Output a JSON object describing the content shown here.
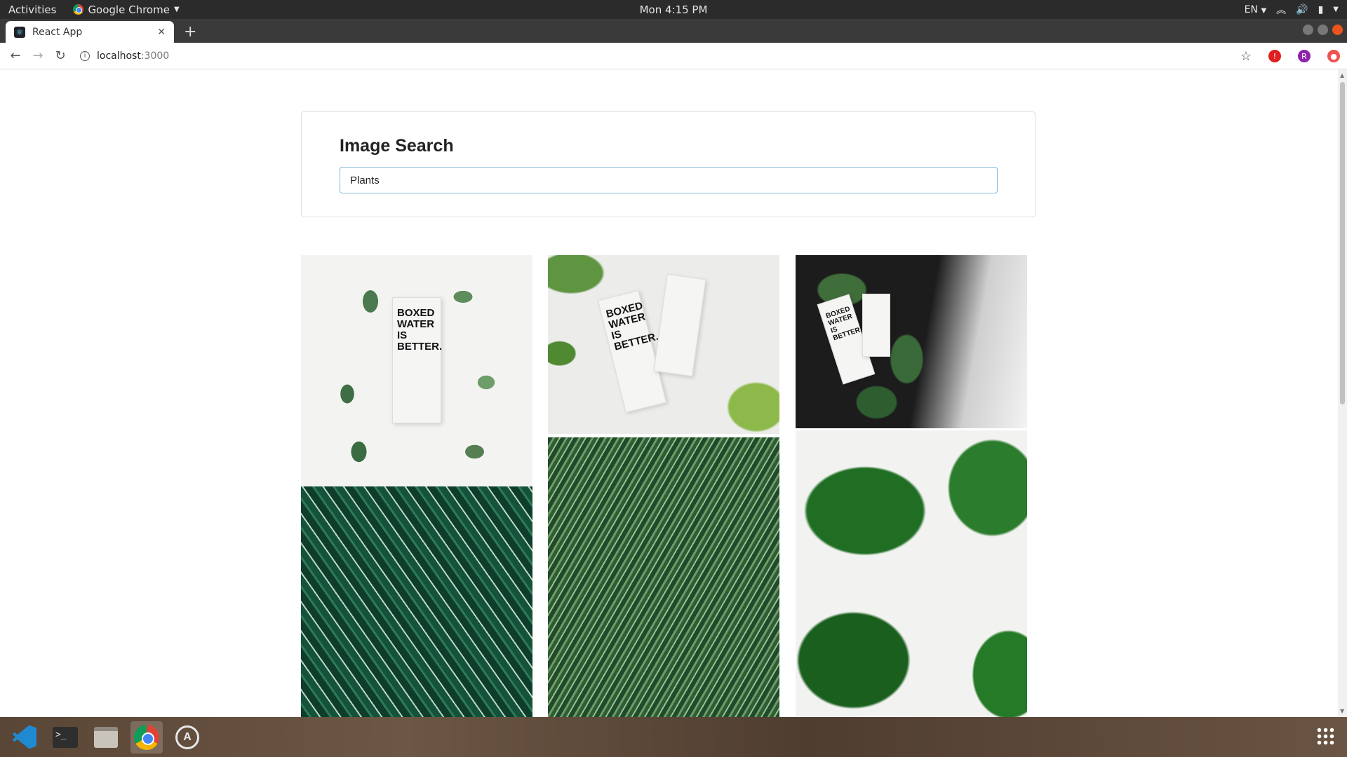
{
  "topbar": {
    "activities": "Activities",
    "app_name": "Google Chrome",
    "clock": "Mon  4:15 PM",
    "language": "EN"
  },
  "browser": {
    "tab_title": "React App",
    "url_host": "localhost",
    "url_port": ":3000",
    "profile_initial": "R"
  },
  "search": {
    "title": "Image Search",
    "value": "Plants"
  },
  "gallery": {
    "images": [
      {
        "subject": "boxed-water-carton-leaves-white"
      },
      {
        "subject": "boxed-water-cartons-fern-white"
      },
      {
        "subject": "boxed-water-cartons-soil"
      },
      {
        "subject": "calathea-leaves"
      },
      {
        "subject": "palm-fronds"
      },
      {
        "subject": "monstera-leaves"
      }
    ],
    "carton_text": "BOXED WATER IS BETTER."
  },
  "dock": {
    "items": [
      "vscode-icon",
      "terminal-icon",
      "files-icon",
      "chrome-icon",
      "software-updater-icon"
    ]
  }
}
